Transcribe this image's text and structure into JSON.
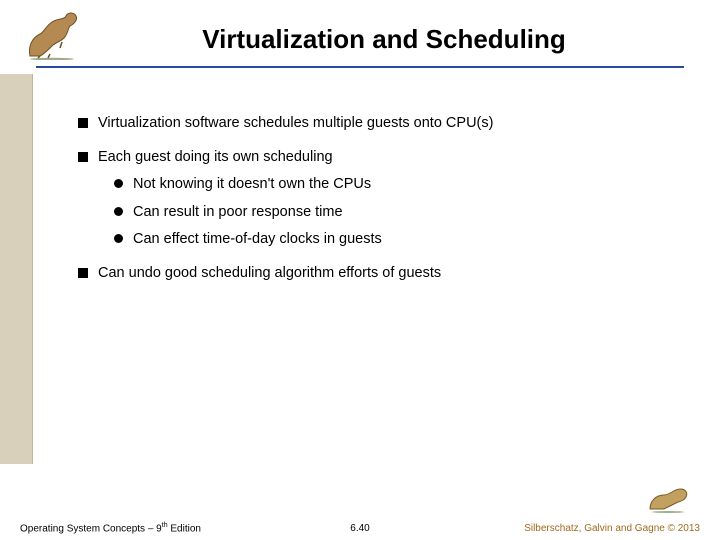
{
  "slide": {
    "title": "Virtualization and Scheduling",
    "bullets": [
      {
        "level": 1,
        "text": "Virtualization software schedules multiple guests onto CPU(s)"
      },
      {
        "level": 1,
        "text": "Each guest doing its own scheduling"
      },
      {
        "level": 2,
        "text": "Not knowing it doesn't own the CPUs"
      },
      {
        "level": 2,
        "text": "Can result in poor response time"
      },
      {
        "level": 2,
        "text": "Can effect time-of-day clocks in guests"
      },
      {
        "level": 1,
        "text": "Can undo good scheduling algorithm efforts of guests"
      }
    ]
  },
  "footer": {
    "left_prefix": "Operating System Concepts – 9",
    "left_suffix": " Edition",
    "center": "6.40",
    "right": "Silberschatz, Galvin and Gagne © 2013"
  },
  "icons": {
    "dino_top": "dinosaur-illustration",
    "dino_bottom": "dinosaur-illustration"
  }
}
